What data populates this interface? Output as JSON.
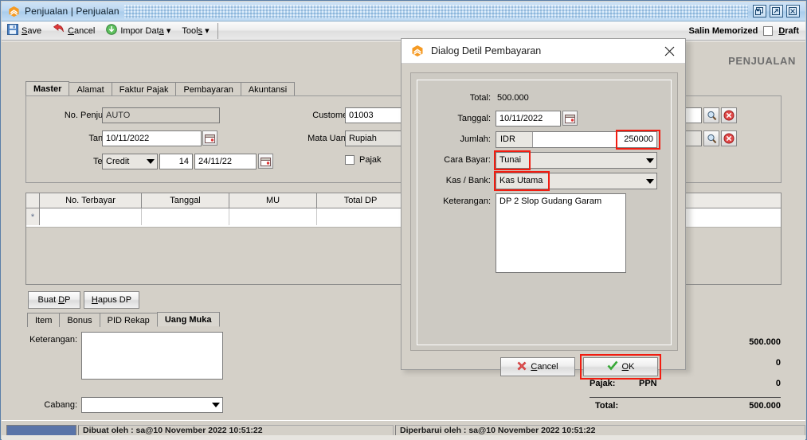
{
  "window": {
    "title": "Penjualan | Penjualan",
    "app_icon": "hexagon-logo-icon",
    "buttons": {
      "restore": "restore-icon",
      "maximize": "maximize-icon",
      "close": "close-icon"
    }
  },
  "toolbar": {
    "save_label": "Save",
    "cancel_label": "Cancel",
    "import_label": "Impor Data",
    "tools_label": "Tools",
    "memorized_label": "Salin Memorized",
    "draft_label": "Draft",
    "draft_checked": false
  },
  "watermark": "PENJUALAN",
  "tabs_main": [
    {
      "label": "Master",
      "active": true
    },
    {
      "label": "Alamat",
      "active": false
    },
    {
      "label": "Faktur Pajak",
      "active": false
    },
    {
      "label": "Pembayaran",
      "active": false
    },
    {
      "label": "Akuntansi",
      "active": false
    }
  ],
  "master_form": {
    "no_penjualan_label": "No. Penjualan:",
    "no_penjualan_value": "AUTO",
    "tanggal_label": "Tanggal:",
    "tanggal_value": "10/11/2022",
    "termin_label": "Termin:",
    "termin_value": "Credit",
    "termin_days": "14",
    "termin_date": "24/11/22",
    "customer_label": "Customer:",
    "customer_value": "01003",
    "mata_uang_label": "Mata Uang:",
    "mata_uang_value": "Rupiah",
    "pajak_label": "Pajak",
    "pajak_checked": false
  },
  "dp_grid": {
    "columns": [
      "No. Terbayar",
      "Tanggal",
      "MU",
      "Total DP"
    ],
    "rows": [
      {
        "marker": "*",
        "cells": [
          "",
          "",
          "",
          ""
        ]
      }
    ]
  },
  "dp_buttons": {
    "buat_label": "Buat DP",
    "hapus_label": "Hapus DP"
  },
  "tabs_detail": [
    {
      "label": "Item",
      "active": false
    },
    {
      "label": "Bonus",
      "active": false
    },
    {
      "label": "PID Rekap",
      "active": false
    },
    {
      "label": "Uang Muka",
      "active": true
    }
  ],
  "detail_form": {
    "keterangan_label": "Keterangan:",
    "keterangan_value": "",
    "cabang_label": "Cabang:",
    "cabang_value": ""
  },
  "totals": {
    "subtotal_value": "500.000",
    "discount_value": "0",
    "pajak_label": "Pajak:",
    "pajak_type": "PPN",
    "pajak_value": "0",
    "total_label": "Total:",
    "total_value": "500.000"
  },
  "dialog": {
    "title": "Dialog Detil Pembayaran",
    "icon": "hexagon-logo-icon",
    "close_icon": "close-icon",
    "fields": {
      "total_label": "Total:",
      "total_value": "500.000",
      "tanggal_label": "Tanggal:",
      "tanggal_value": "10/11/2022",
      "jumlah_label": "Jumlah:",
      "jumlah_currency": "IDR",
      "jumlah_value": "250000",
      "cara_bayar_label": "Cara Bayar:",
      "cara_bayar_value": "Tunai",
      "kas_bank_label": "Kas / Bank:",
      "kas_bank_value": "Kas Utama",
      "keterangan_label": "Keterangan:",
      "keterangan_value": "DP 2 Slop Gudang Garam"
    },
    "cancel_label": "Cancel",
    "ok_label": "OK"
  },
  "statusbar": {
    "created": "Dibuat oleh : sa@10 November 2022  10:51:22",
    "updated": "Diperbarui oleh : sa@10 November 2022  10:51:22"
  },
  "colors": {
    "highlight": "#f21c10",
    "titlebar": "#bdd8f2",
    "face": "#d4d0c8",
    "accent_blue": "#5a74a8",
    "logo_orange": "#f59a23"
  }
}
